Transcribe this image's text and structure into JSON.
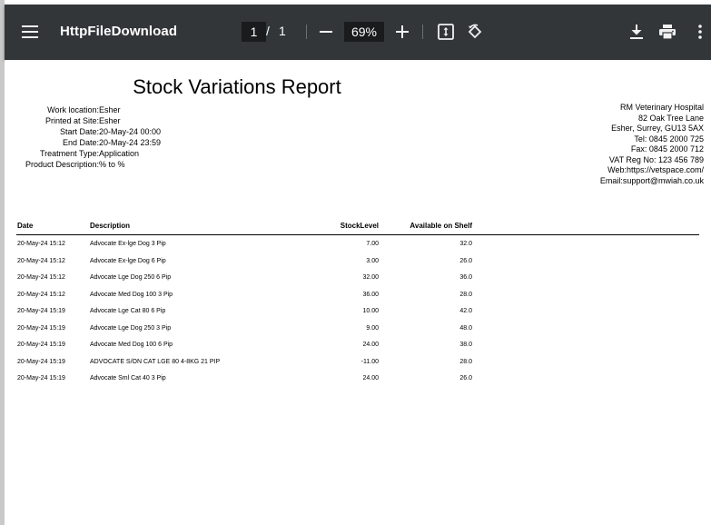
{
  "toolbar": {
    "menu_icon": "hamburger-menu-icon",
    "title": "HttpFileDownload",
    "current_page": "1",
    "page_separator": "/",
    "total_pages": "1",
    "zoom_level": "69%",
    "colors": {
      "background": "#323639",
      "input_bg": "#191b1c",
      "text": "#f1f1f1"
    }
  },
  "report": {
    "title": "Stock Variations Report",
    "info": [
      {
        "label": "Work location:",
        "value": "Esher"
      },
      {
        "label": "Printed at Site:",
        "value": "Esher"
      },
      {
        "label": "Start Date:",
        "value": "20-May-24 00:00"
      },
      {
        "label": "End Date:",
        "value": "20-May-24 23:59"
      },
      {
        "label": "Treatment Type:",
        "value": "Application"
      },
      {
        "label": "Product Description:",
        "value": "% to %"
      }
    ],
    "address": [
      "RM Veterinary Hospital",
      "82 Oak Tree Lane",
      "Esher, Surrey, GU13 5AX",
      "Tel: 0845 2000 725",
      "Fax: 0845 2000 712",
      "VAT Reg No: 123 456 789",
      "Web:https://vetspace.com/",
      "Email:support@mwiah.co.uk"
    ],
    "columns": {
      "date": "Date",
      "description": "Description",
      "stock_level": "StockLevel",
      "available": "Available on Shelf"
    },
    "rows": [
      {
        "date": "20-May-24 15:12",
        "description": "Advocate Ex-lge Dog 3 Pip",
        "stock_level": "7.00",
        "available": "32.0"
      },
      {
        "date": "20-May-24 15:12",
        "description": "Advocate Ex-lge Dog 6 Pip",
        "stock_level": "3.00",
        "available": "26.0"
      },
      {
        "date": "20-May-24 15:12",
        "description": "Advocate Lge Dog 250 6 Pip",
        "stock_level": "32.00",
        "available": "36.0"
      },
      {
        "date": "20-May-24 15:12",
        "description": "Advocate Med Dog 100 3 Pip",
        "stock_level": "36.00",
        "available": "28.0"
      },
      {
        "date": "20-May-24 15:19",
        "description": "Advocate Lge Cat 80 6 Pip",
        "stock_level": "10.00",
        "available": "42.0"
      },
      {
        "date": "20-May-24 15:19",
        "description": "Advocate Lge Dog 250 3 Pip",
        "stock_level": "9.00",
        "available": "48.0"
      },
      {
        "date": "20-May-24 15:19",
        "description": "Advocate Med Dog 100 6 Pip",
        "stock_level": "24.00",
        "available": "38.0"
      },
      {
        "date": "20-May-24 15:19",
        "description": "ADVOCATE S/ON CAT LGE 80 4-8KG 21 PIP",
        "stock_level": "-11.00",
        "available": "28.0"
      },
      {
        "date": "20-May-24 15:19",
        "description": "Advocate Sml Cat 40 3 Pip",
        "stock_level": "24.00",
        "available": "26.0"
      }
    ]
  }
}
